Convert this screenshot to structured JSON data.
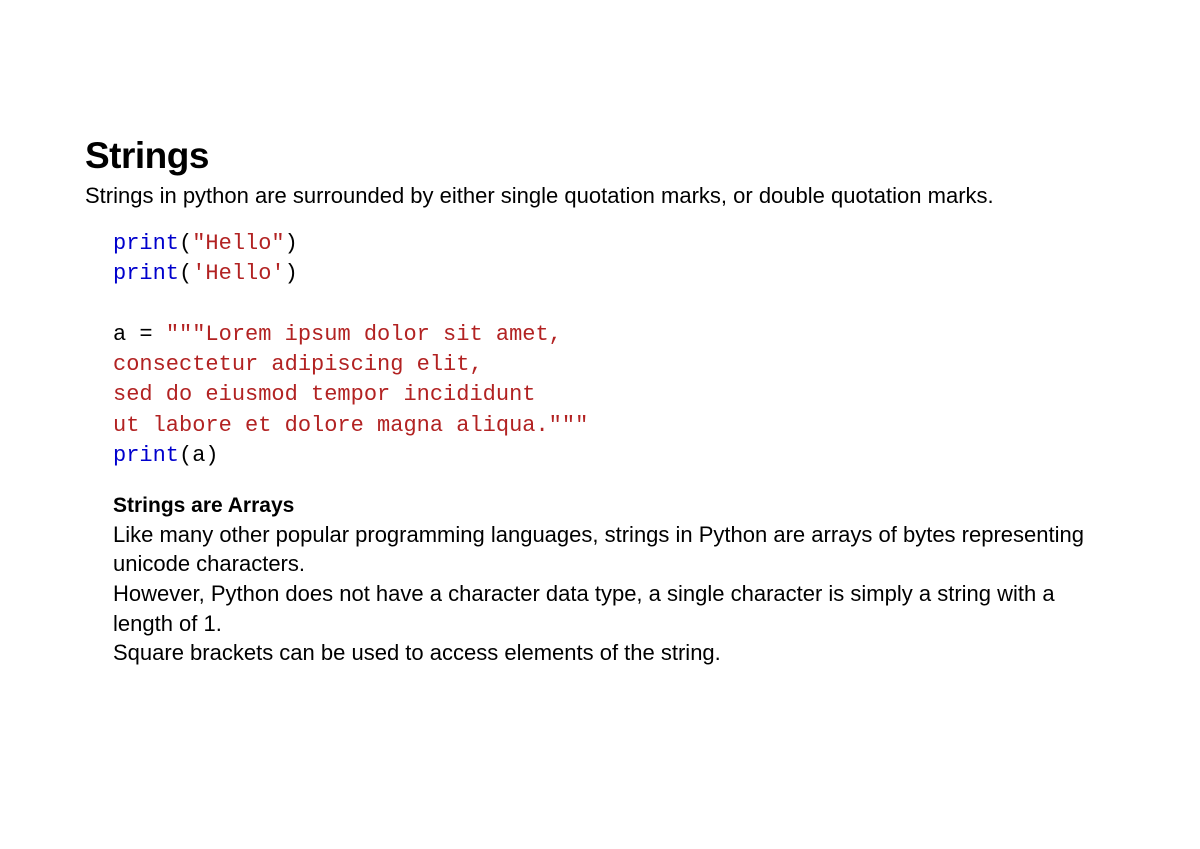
{
  "heading": "Strings",
  "intro": "Strings in python are surrounded by either single quotation marks, or double quotation marks.",
  "code": {
    "line1": {
      "kw": "print",
      "open": "(",
      "str": "\"Hello\"",
      "close": ")"
    },
    "line2": {
      "kw": "print",
      "open": "(",
      "str": "'Hello'",
      "close": ")"
    },
    "assign": {
      "lhs": "a = ",
      "s1": "\"\"\"Lorem ipsum dolor sit amet,",
      "s2": "consectetur adipiscing elit,",
      "s3": "sed do eiusmod tempor incididunt",
      "s4": "ut labore et dolore magna aliqua.\"\"\""
    },
    "line3": {
      "kw": "print",
      "open": "(a)",
      "close": ""
    }
  },
  "subheading": "Strings are Arrays",
  "subbody": {
    "p1": "Like many other popular programming languages, strings in Python are arrays of bytes representing unicode characters.",
    "p2": "However, Python does not have a character data type, a single character is simply a string with a length of 1.",
    "p3": "Square brackets can be used to access elements of the string."
  }
}
